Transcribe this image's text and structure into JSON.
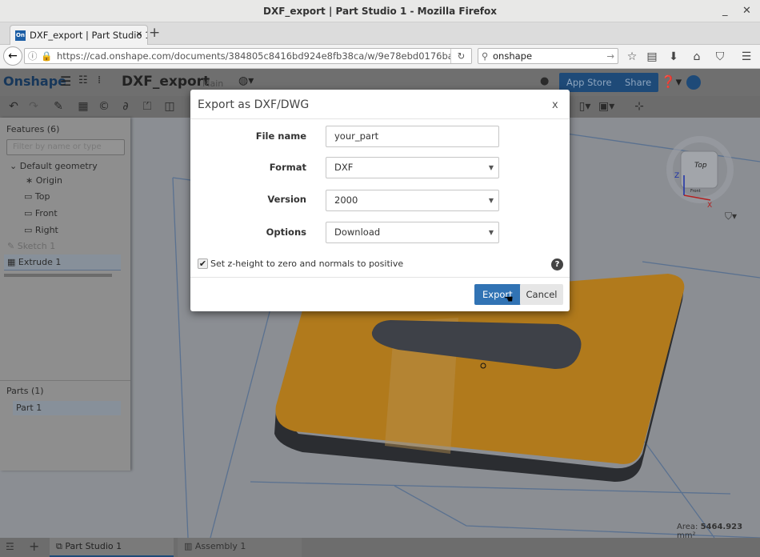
{
  "window": {
    "title": "DXF_export | Part Studio 1 - Mozilla Firefox",
    "minimize": "_",
    "close": "✕"
  },
  "browser": {
    "tab_label": "DXF_export | Part Studio 1",
    "tab_favicon": "On",
    "tab_close": "✕",
    "new_tab": "+",
    "url": "https://cad.onshape.com/documents/384805c8416bd924e8fb38ca/w/9e78ebd0176ba0baafa2",
    "search_value": "onshape"
  },
  "header": {
    "logo": "Onshape",
    "doc_title": "DXF_export",
    "branch": "Main",
    "app_store": "App Store",
    "share": "Share"
  },
  "features": {
    "title": "Features (6)",
    "filter_placeholder": "Filter by name or type",
    "items": [
      {
        "label": "Default geometry",
        "icon": "chevron-down-icon"
      },
      {
        "label": "Origin",
        "icon": "origin-icon"
      },
      {
        "label": "Top",
        "icon": "plane-icon"
      },
      {
        "label": "Front",
        "icon": "plane-icon"
      },
      {
        "label": "Right",
        "icon": "plane-icon"
      },
      {
        "label": "Sketch 1",
        "icon": "sketch-icon"
      },
      {
        "label": "Extrude 1",
        "icon": "extrude-icon"
      }
    ]
  },
  "parts": {
    "title": "Parts (1)",
    "items": [
      "Part 1"
    ]
  },
  "viewcube": {
    "face": "Top",
    "front": "Front",
    "z": "Z",
    "x": "X"
  },
  "area": {
    "label": "Area:",
    "value": "5464.923",
    "unit": "mm²"
  },
  "bottom_tabs": [
    {
      "label": "Part Studio 1",
      "active": true
    },
    {
      "label": "Assembly 1",
      "active": false
    }
  ],
  "dialog": {
    "title": "Export as DXF/DWG",
    "close": "x",
    "fields": [
      {
        "label": "File name",
        "value": "your_part"
      },
      {
        "label": "Format",
        "value": "DXF"
      },
      {
        "label": "Version",
        "value": "2000"
      },
      {
        "label": "Options",
        "value": "Download"
      }
    ],
    "checkbox_label": "Set z-height to zero and normals to positive",
    "checkbox_checked": true,
    "export": "Export",
    "cancel": "Cancel"
  },
  "colors": {
    "accent": "#3173b4",
    "part": "#b17a1c"
  }
}
